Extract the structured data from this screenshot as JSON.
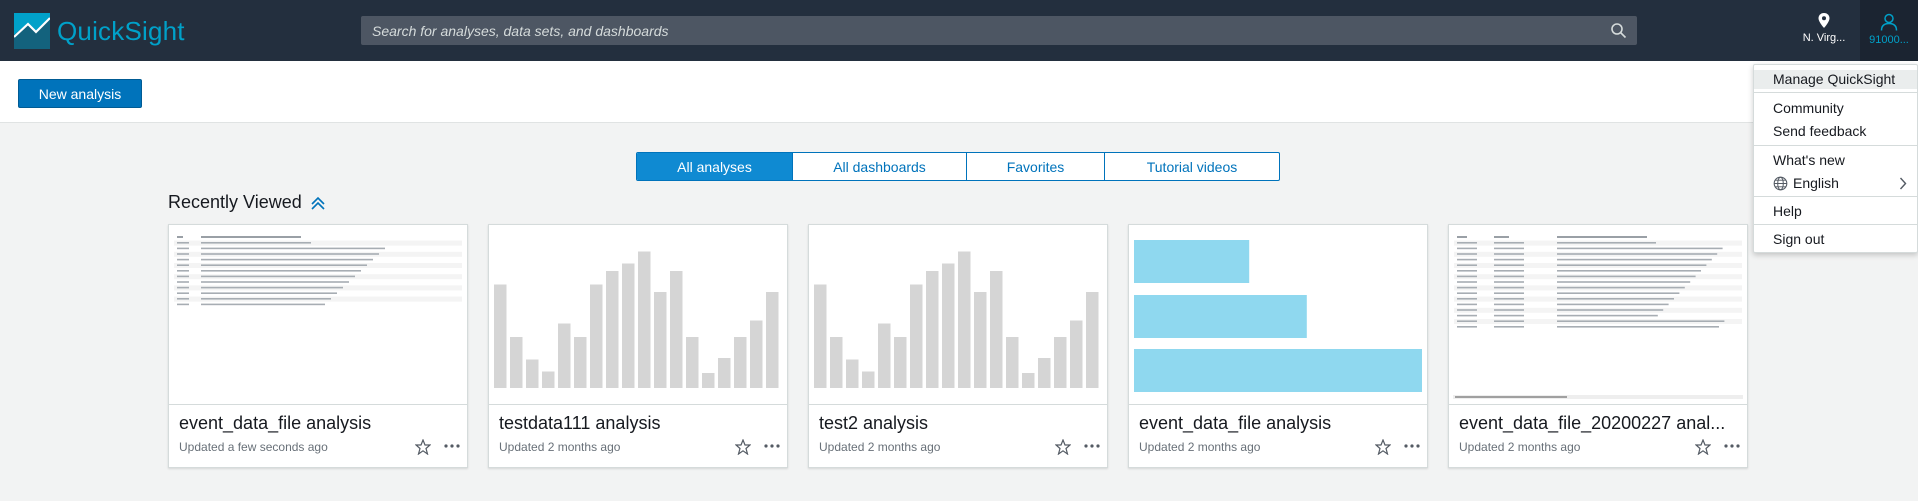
{
  "app": {
    "name": "QuickSight"
  },
  "header": {
    "search_placeholder": "Search for analyses, data sets, and dashboards",
    "region_label": "N. Virg...",
    "user_label": "91000...",
    "accent": "#00a1c9",
    "bg": "#232f3e"
  },
  "toolbar": {
    "new_analysis_label": "New analysis"
  },
  "tabs": [
    {
      "label": "All analyses",
      "active": true
    },
    {
      "label": "All dashboards",
      "active": false
    },
    {
      "label": "Favorites",
      "active": false
    },
    {
      "label": "Tutorial videos",
      "active": false
    }
  ],
  "section": {
    "title": "Recently Viewed"
  },
  "cards": [
    {
      "name": "event_data_file analysis",
      "updated": "Updated a few seconds ago",
      "thumb": "table"
    },
    {
      "name": "testdata111 analysis",
      "updated": "Updated 2 months ago",
      "thumb": "bars",
      "bar_values": [
        69,
        34,
        19,
        11,
        43,
        34,
        69,
        78,
        83,
        91,
        64,
        78,
        34,
        10,
        20,
        34,
        45,
        64
      ]
    },
    {
      "name": "test2 analysis",
      "updated": "Updated 2 months ago",
      "thumb": "bars",
      "bar_values": [
        69,
        34,
        19,
        11,
        43,
        34,
        69,
        78,
        83,
        91,
        64,
        78,
        34,
        10,
        20,
        34,
        45,
        64
      ]
    },
    {
      "name": "event_data_file analysis",
      "updated": "Updated 2 months ago",
      "thumb": "hbars",
      "hbar_values": [
        40,
        60,
        100
      ]
    },
    {
      "name": "event_data_file_20200227 anal...",
      "updated": "Updated 2 months ago",
      "thumb": "table2"
    }
  ],
  "user_menu": {
    "items": [
      {
        "label": "Manage QuickSight",
        "highlighted": true
      },
      {
        "label": "Community"
      },
      {
        "label": "Send feedback"
      },
      {
        "label": "What's new"
      },
      {
        "label": "English"
      },
      {
        "label": "Help"
      },
      {
        "label": "Sign out"
      }
    ]
  },
  "colors": {
    "primary_button": "#0073bb",
    "active_tab": "#0f8ad2",
    "bar_gray": "#d5d5d5",
    "hbar_blue": "#8fd8ef"
  }
}
